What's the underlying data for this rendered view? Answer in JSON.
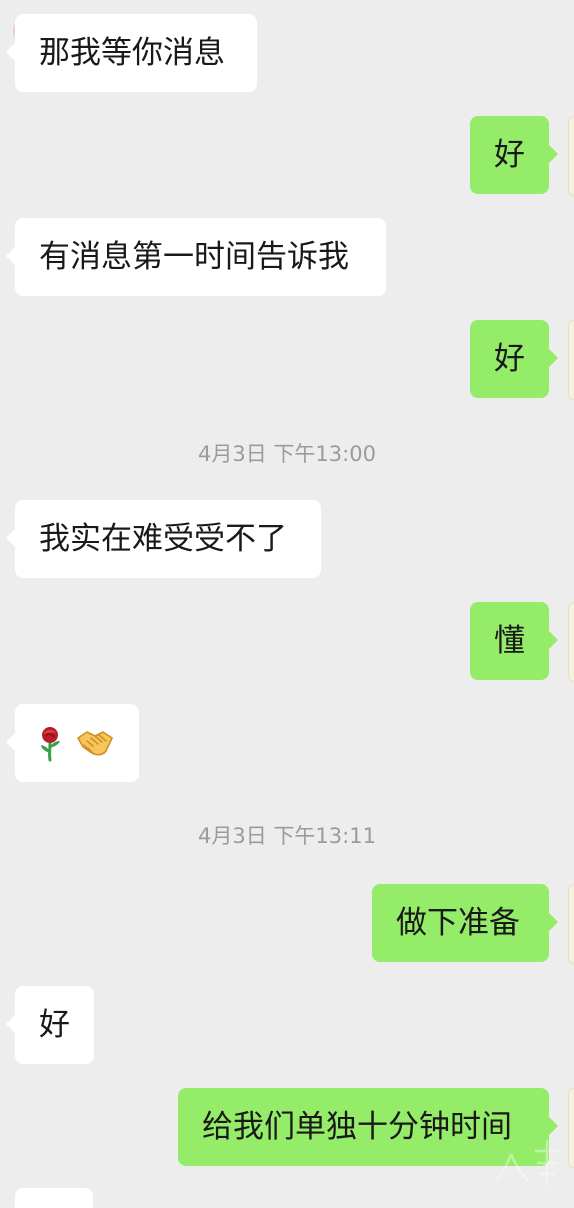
{
  "messages": [
    {
      "text": "那我等你消息"
    },
    {
      "text": "好"
    },
    {
      "text": "有消息第一时间告诉我"
    },
    {
      "text": "好"
    },
    {
      "text": "4月3日 下午13:00"
    },
    {
      "text": "我实在难受受不了"
    },
    {
      "text": "懂"
    },
    {
      "emojis": [
        "rose-emoji",
        "handshake-emoji"
      ]
    },
    {
      "text": "4月3日 下午13:11"
    },
    {
      "text": "做下准备"
    },
    {
      "text": "好"
    },
    {
      "text": "给我们单独十分钟时间"
    }
  ],
  "colors": {
    "background": "#ededed",
    "incoming_bubble": "#ffffff",
    "outgoing_bubble": "#95ec69",
    "timestamp": "#9b9b9b"
  }
}
